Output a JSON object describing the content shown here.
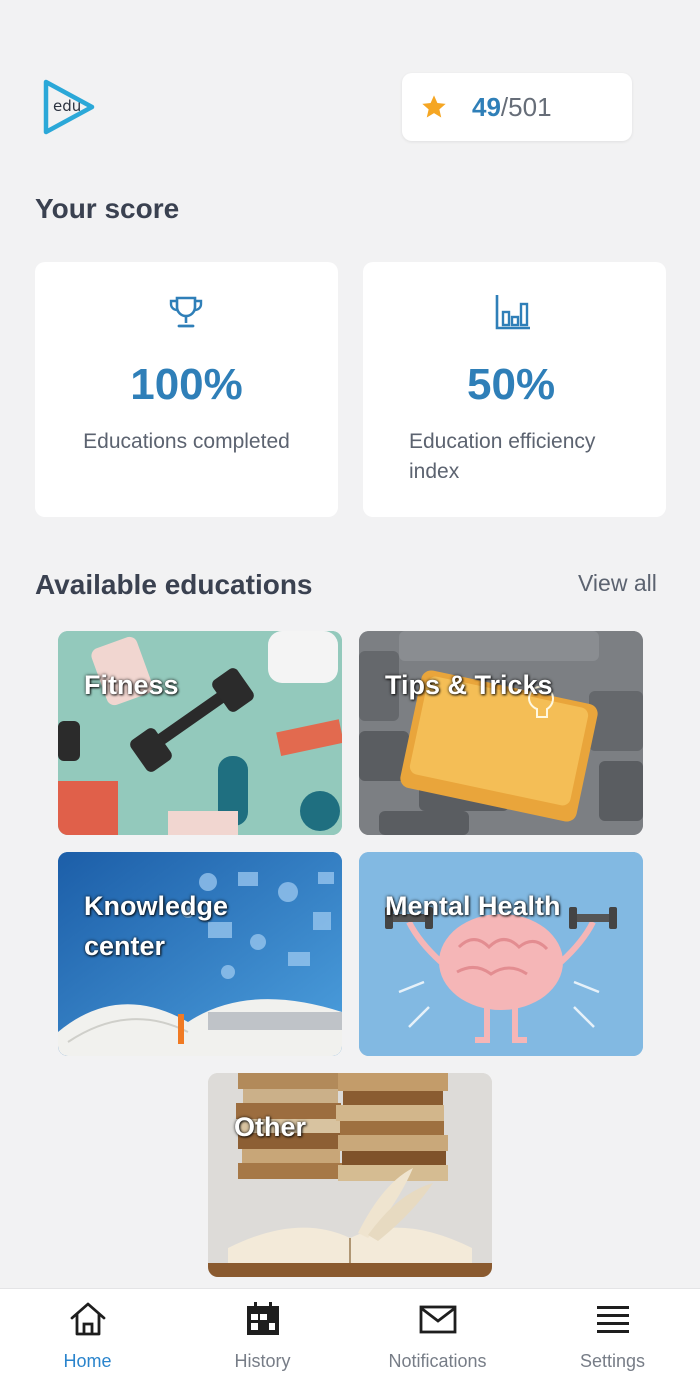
{
  "header": {
    "logo_text": "edu",
    "score_current": "49",
    "score_total": "/501"
  },
  "score_section": {
    "title": "Your score",
    "cards": [
      {
        "icon": "trophy-icon",
        "value": "100%",
        "label": "Educations completed"
      },
      {
        "icon": "bar-chart-icon",
        "value": "50%",
        "label": "Education efficiency index"
      }
    ]
  },
  "educations": {
    "title": "Available educations",
    "view_all": "View all",
    "items": [
      {
        "label": "Fitness"
      },
      {
        "label": "Tips & Tricks"
      },
      {
        "label": "Knowledge center"
      },
      {
        "label": "Mental Health"
      },
      {
        "label": "Other"
      }
    ]
  },
  "tabbar": {
    "items": [
      {
        "label": "Home",
        "icon": "home-icon",
        "active": true
      },
      {
        "label": "History",
        "icon": "calendar-icon",
        "active": false
      },
      {
        "label": "Notifications",
        "icon": "mail-icon",
        "active": false
      },
      {
        "label": "Settings",
        "icon": "menu-icon",
        "active": false
      }
    ]
  },
  "colors": {
    "accent": "#2f7fb8",
    "tab_active": "#2a84cc",
    "star": "#f5a623",
    "background": "#f2f2f3"
  }
}
